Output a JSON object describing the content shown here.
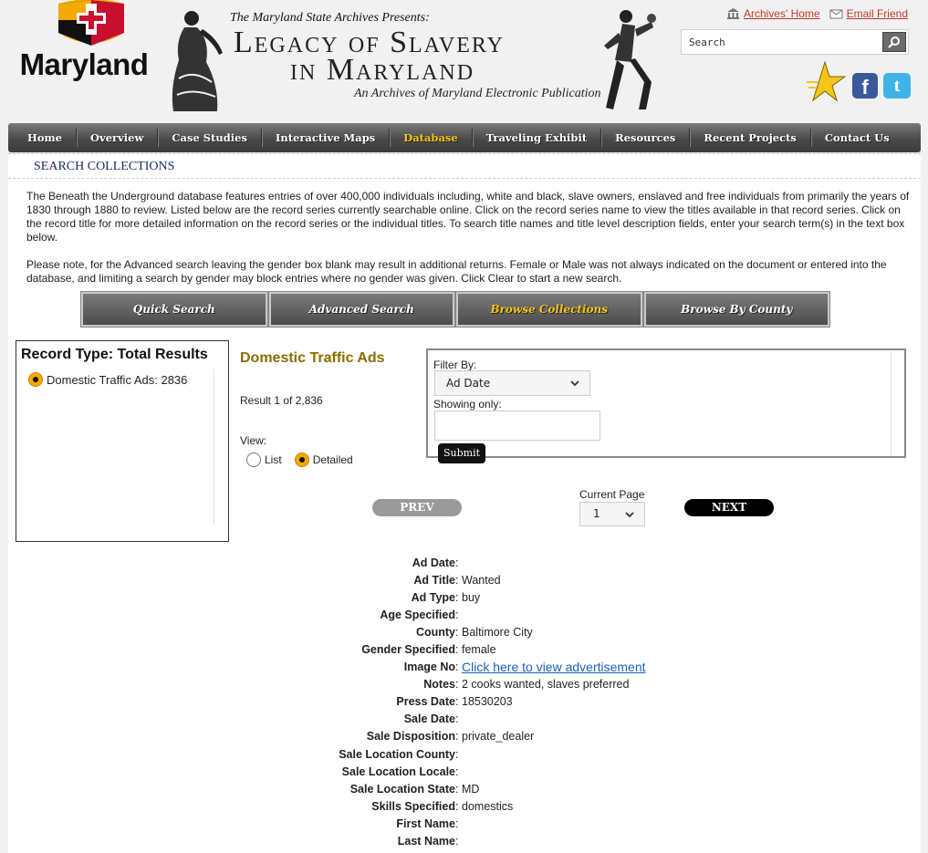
{
  "logo": {
    "text": "Maryland"
  },
  "banner": {
    "presents": "The Maryland State Archives Presents:",
    "title_line1": "Legacy of Slavery",
    "title_line2": "in Maryland",
    "subtitle": "An Archives of Maryland Electronic Publication"
  },
  "toplinks": {
    "home": "Archives' Home",
    "email": "Email Friend"
  },
  "search": {
    "value": "Search"
  },
  "nav": {
    "items": [
      {
        "label": "Home"
      },
      {
        "label": "Overview"
      },
      {
        "label": "Case Studies"
      },
      {
        "label": "Interactive Maps"
      },
      {
        "label": "Database",
        "active": true
      },
      {
        "label": "Traveling Exhibit"
      },
      {
        "label": "Resources"
      },
      {
        "label": "Recent Projects"
      },
      {
        "label": "Contact Us"
      }
    ]
  },
  "section_title": "SEARCH COLLECTIONS",
  "intro": {
    "p1": "The Beneath the Underground database features entries of over 400,000 individuals including, white and black, slave owners, enslaved and free individuals from primarily the years of 1830 through 1880 to review. Listed below are the record series currently searchable online. Click on the record series name to view the titles available in that record series. Click on the record title for more detailed information on the record series or the individual titles. To search title names and title level description fields, enter your search term(s) in the text box below.",
    "p2": "Please note, for the Advanced search leaving the gender box blank may result in additional returns. Female or Male was not always indicated on the document or entered into the database, and limiting a search by gender may block entries where no gender was given. Click Clear to start a new search."
  },
  "tabs": [
    {
      "label": "Quick Search"
    },
    {
      "label": "Advanced Search"
    },
    {
      "label": "Browse Collections",
      "active": true
    },
    {
      "label": "Browse By County"
    }
  ],
  "record_type": {
    "header": "Record Type: Total Results",
    "option": "Domestic Traffic Ads: 2836"
  },
  "collection": {
    "title": "Domestic Traffic Ads",
    "result": "Result 1 of 2,836",
    "view_label": "View:",
    "view_list": "List",
    "view_detailed": "Detailed"
  },
  "filter": {
    "filter_by_label": "Filter By:",
    "filter_by_value": "Ad Date",
    "showing_label": "Showing only:",
    "submit": "Submit"
  },
  "pager": {
    "prev": "PREV",
    "next": "NEXT",
    "current_label": "Current Page",
    "current_value": "1"
  },
  "record": [
    {
      "key": "Ad Date",
      "value": ""
    },
    {
      "key": "Ad Title",
      "value": "Wanted"
    },
    {
      "key": "Ad Type",
      "value": "buy"
    },
    {
      "key": "Age Specified",
      "value": ""
    },
    {
      "key": "County",
      "value": "Baltimore City"
    },
    {
      "key": "Gender Specified",
      "value": "female"
    },
    {
      "key": "Image No",
      "value": "Click here to view advertisement",
      "link": true
    },
    {
      "key": "Notes",
      "value": "2 cooks wanted, slaves preferred"
    },
    {
      "key": "Press Date",
      "value": "18530203"
    },
    {
      "key": "Sale Date",
      "value": ""
    },
    {
      "key": "Sale Disposition",
      "value": "private_dealer"
    },
    {
      "key": "Sale Location County",
      "value": ""
    },
    {
      "key": "Sale Location Locale",
      "value": ""
    },
    {
      "key": "Sale Location State",
      "value": "MD"
    },
    {
      "key": "Skills Specified",
      "value": "domestics"
    },
    {
      "key": "First Name",
      "value": ""
    },
    {
      "key": "Last Name",
      "value": ""
    }
  ]
}
